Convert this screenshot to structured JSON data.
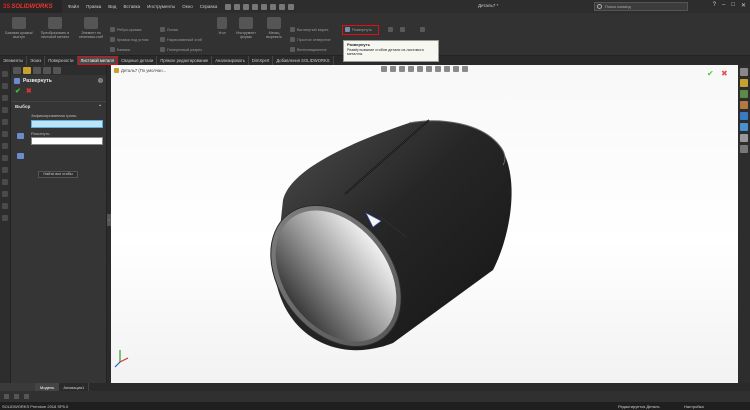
{
  "app": {
    "brand_ds": "3S",
    "brand_sw": "SOLIDWORKS",
    "menus": [
      "Файл",
      "Правка",
      "Вид",
      "Вставка",
      "Инструменты",
      "Окно",
      "Справка"
    ],
    "doc_title": "Деталь7 *",
    "search_placeholder": "Поиск команд"
  },
  "ribbon": {
    "big_buttons": [
      {
        "label": "Базовая кромка/выступ"
      },
      {
        "label": "Преобразовать в листовой металл"
      },
      {
        "label": "Элемент по сечениям-сгиб"
      }
    ],
    "col1": [
      "Ребро-кромка",
      "Кромка под углом",
      "Каемка"
    ],
    "col2": [
      "Линия",
      "Нарисованный сгиб",
      "Поперечный разрез"
    ],
    "col3_big": "Угол",
    "col4_big": "Инструмент формы",
    "col5_big": "Месяц вырезать",
    "col6": [
      "Вытянутый вырез",
      "Простое отверстие",
      "Вентиляционное"
    ],
    "razvernut": "Развернуть",
    "tooltip_title": "Развернуть",
    "tooltip_text": "Развёртывание сгибов детали из листового металла."
  },
  "tabs": [
    "Элементы",
    "Эскиз",
    "Поверхности",
    "Листовой металл",
    "Сварные детали",
    "Прямое редактирование",
    "Анализировать",
    "DimXpert",
    "Добавления SOLIDWORKS"
  ],
  "active_tab_index": 3,
  "panel": {
    "feature_title": "Развернуть",
    "section_title": "Выбор",
    "fixed_face_label": "Зафиксированная грань:",
    "bends_label": "Разогнуть:",
    "find_button": "Найти все сгибы"
  },
  "viewport": {
    "crumb": "Деталь7 (По умолчан..."
  },
  "bottom_tabs": [
    "Модель",
    "Анимация1"
  ],
  "status": {
    "left": "SOLIDWORKS Premium 2018 SP5.0",
    "mode": "Редактируется Деталь",
    "settings": "Настройка"
  }
}
